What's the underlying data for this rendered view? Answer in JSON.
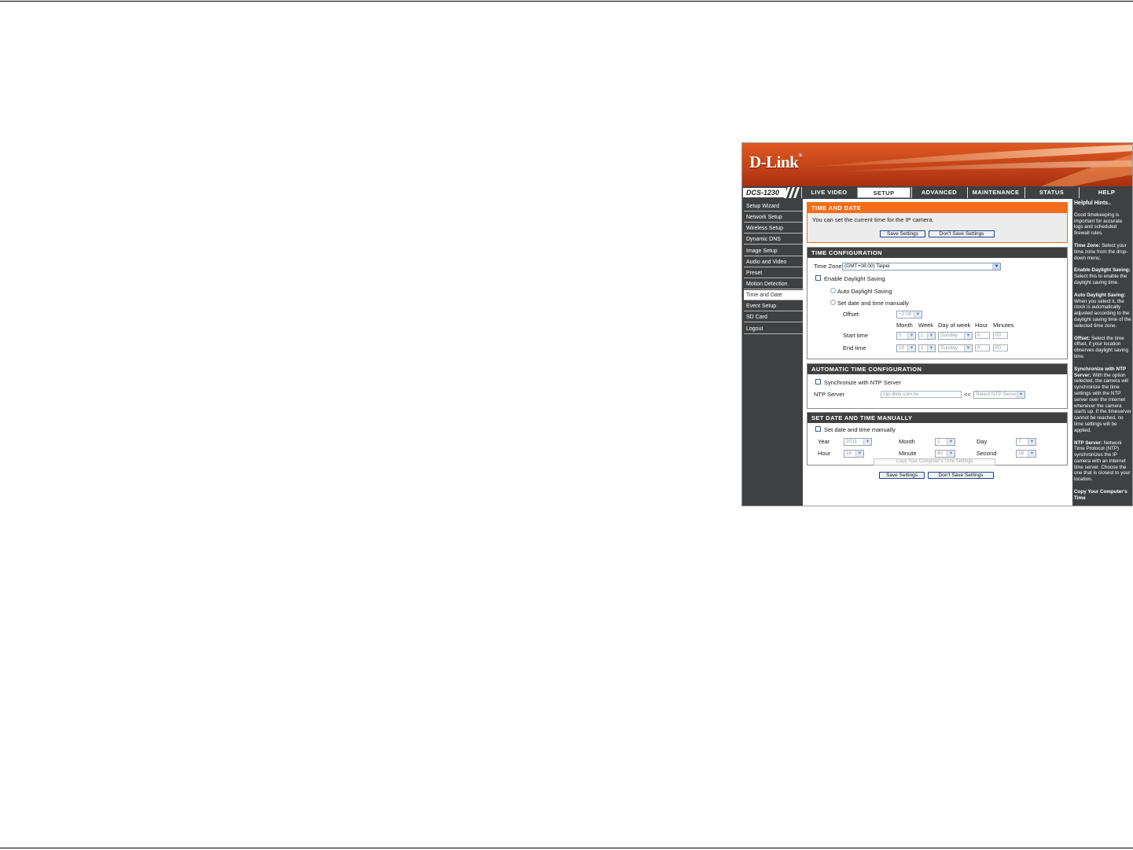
{
  "brand": {
    "name": "D-Link",
    "mark": "®"
  },
  "model": "DCS-1230",
  "nav": {
    "tabs": [
      {
        "label": "LIVE VIDEO"
      },
      {
        "label": "SETUP"
      },
      {
        "label": "ADVANCED"
      },
      {
        "label": "MAINTENANCE"
      },
      {
        "label": "STATUS"
      },
      {
        "label": "HELP"
      }
    ],
    "active": "SETUP"
  },
  "sidebar": {
    "items": [
      {
        "label": "Setup Wizard"
      },
      {
        "label": "Network Setup"
      },
      {
        "label": "Wireless Setup"
      },
      {
        "label": "Dynamic DNS"
      },
      {
        "label": "Image Setup"
      },
      {
        "label": "Audio and Video"
      },
      {
        "label": "Preset"
      },
      {
        "label": "Motion Detection"
      },
      {
        "label": "Time and Date"
      },
      {
        "label": "Event Setup"
      },
      {
        "label": "SD Card"
      },
      {
        "label": "Logout"
      }
    ],
    "active": "Time and Date"
  },
  "time_and_date": {
    "title": "TIME AND DATE",
    "description": "You can set the current time for the IP camera.",
    "save_label": "Save Settings",
    "dont_save_label": "Don't Save Settings"
  },
  "time_config": {
    "title": "TIME CONFIGURATION",
    "time_zone_label": "Time Zone",
    "time_zone_value": "(GMT+08:00) Taipei",
    "enable_dst_label": "Enable Daylight Saving",
    "auto_dst_label": "Auto Daylight Saving",
    "manual_dst_label": "Set date and time manually",
    "offset_label": "Offset:",
    "offset_value": "+2:00",
    "columns": {
      "month": "Month",
      "week": "Week",
      "day_of_week": "Day of week",
      "hour": "Hour",
      "minutes": "Minutes"
    },
    "start": {
      "label": "Start time",
      "month": "5",
      "week": "1",
      "day": "Sunday",
      "hour": "0",
      "minutes": "00"
    },
    "end": {
      "label": "End time",
      "month": "10",
      "week": "1",
      "day": "Sunday",
      "hour": "0",
      "minutes": "00"
    }
  },
  "auto_time": {
    "title": "AUTOMATIC TIME CONFIGURATION",
    "sync_label": "Synchronize with NTP Server",
    "ntp_label": "NTP Server",
    "ntp_value": "ntp.dlink.com.tw",
    "arrow": "<<",
    "select_ntp": "Select NTP Server"
  },
  "manual_time": {
    "title": "SET DATE AND TIME MANUALLY",
    "set_label": "Set date and time manually",
    "year_label": "Year",
    "year_value": "2011",
    "month_label": "Month",
    "month_value": "1",
    "day_label": "Day",
    "day_value": "7",
    "hour_label": "Hour",
    "hour_value": "16",
    "minute_label": "Minute",
    "minute_value": "40",
    "second_label": "Second",
    "second_value": "18",
    "copy_label": "Copy Your Computer's Time Settings"
  },
  "bottom": {
    "save_label": "Save Settings",
    "dont_save_label": "Don't Save Settings"
  },
  "hints": {
    "header": "Helpful Hints..",
    "intro": "Good timekeeping is important for accurate logs and scheduled firewall rules.",
    "items": [
      {
        "title": "Time Zone:",
        "text": "Select your time zone from the drop-down menu."
      },
      {
        "title": "Enable Daylight Saving:",
        "text": "Select this to enable the daylight saving time."
      },
      {
        "title": "Auto Daylight Saving:",
        "text": "When you select it, the clock is automatically adjusted according to the daylight saving time of the selected time zone."
      },
      {
        "title": "Offset:",
        "text": "Select the time offset, if your location observes daylight saving time."
      },
      {
        "title": "Synchronize with NTP Server:",
        "text": "With the option selected, the camera will synchronize the time settings with the NTP server over the Internet whenever the camera starts up. If the timeserver cannot be reached, no time settings will be applied."
      },
      {
        "title": "NTP Server:",
        "text": "Network Time Protocol (NTP) synchronizes the IP camera with an Internet time server. Choose the one that is closest to your location."
      },
      {
        "title": "Copy Your Computer's Time",
        "text": ""
      }
    ]
  },
  "colors": {
    "orange": "#f36d18",
    "banner": "#c5401a",
    "dark": "#3f4042",
    "accent_blue": "#1c3f8a"
  }
}
